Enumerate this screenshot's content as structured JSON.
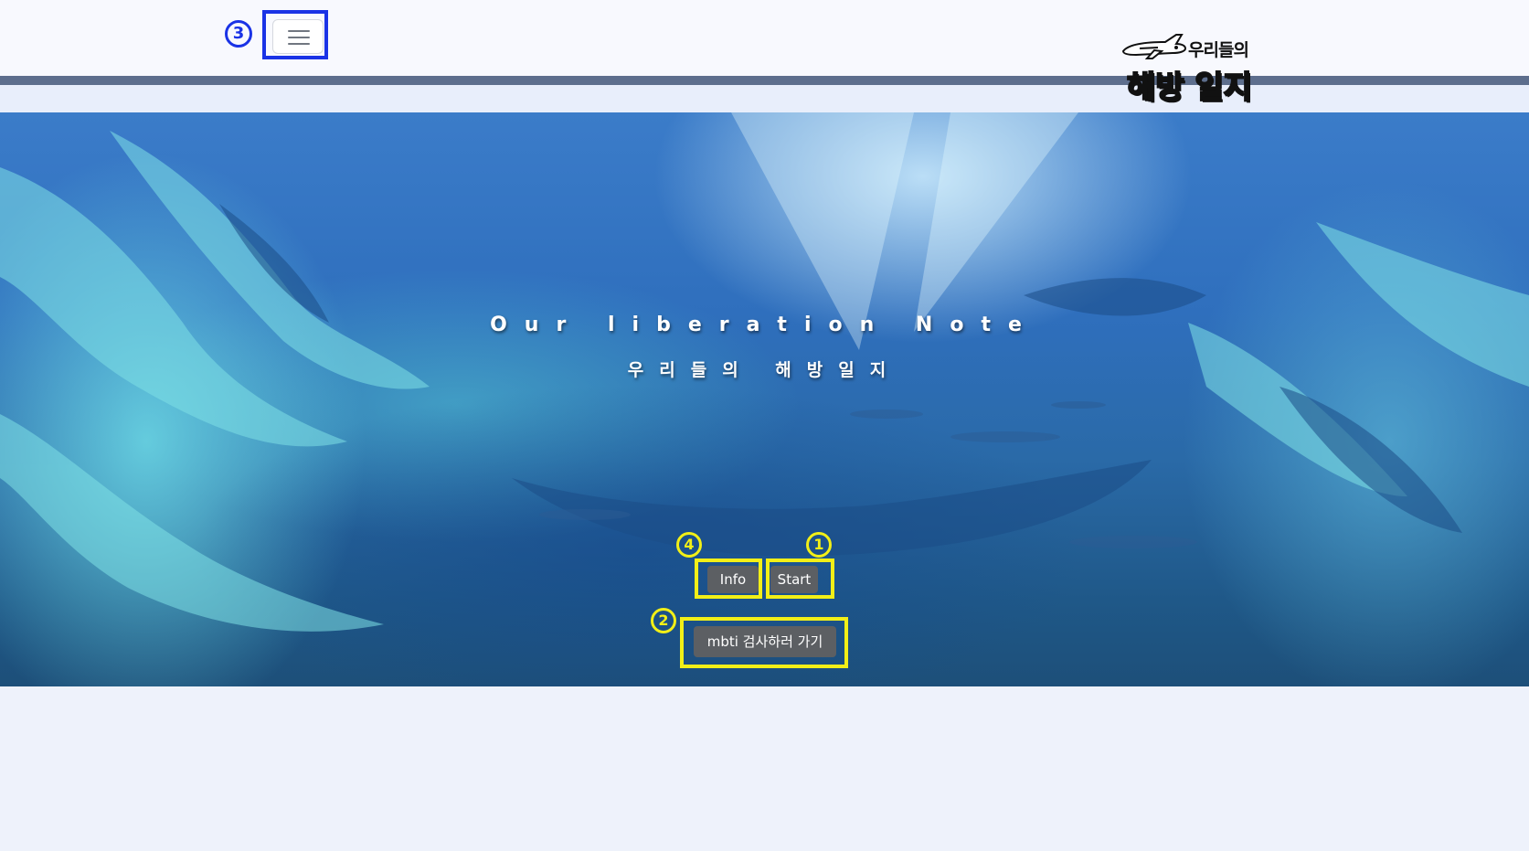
{
  "header": {
    "menu_button_label": "Toggle navigation",
    "menu_marker": "3",
    "logo": {
      "line1": "우리들의",
      "line2": "해방 일지",
      "icon": "airplane-icon"
    }
  },
  "hero": {
    "title": "Our liberation Note",
    "subtitle": "우리들의 해방일지",
    "buttons": {
      "info_label": "Info",
      "start_label": "Start",
      "mbti_label": "mbti 검사하러 가기"
    },
    "markers": {
      "info": "4",
      "start": "1",
      "mbti": "2"
    }
  },
  "colors": {
    "highlight_blue": "#1a33e6",
    "highlight_yellow": "#f2ef17",
    "button_bg": "#5c5f63",
    "header_stripe": "#5d6e8d"
  }
}
